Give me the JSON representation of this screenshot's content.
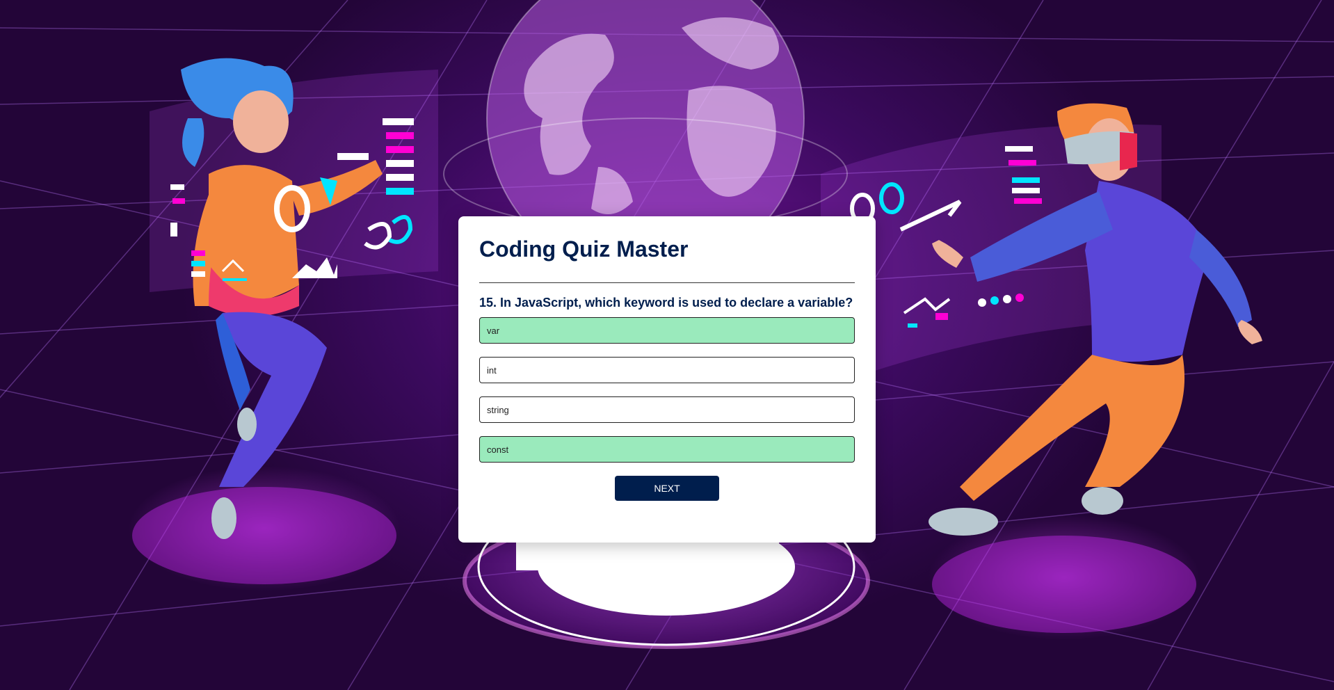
{
  "quiz": {
    "title": "Coding Quiz Master",
    "question": "15. In JavaScript, which keyword is used to declare a variable?",
    "answers": [
      {
        "text": "var",
        "state": "correct"
      },
      {
        "text": "int",
        "state": "neutral"
      },
      {
        "text": "string",
        "state": "neutral"
      },
      {
        "text": "const",
        "state": "correct"
      }
    ],
    "next_label": "NEXT"
  },
  "colors": {
    "primary": "#001e4d",
    "correct": "#9aeabc",
    "background": "#3b0a5e",
    "accent_magenta": "#ff00d4",
    "accent_cyan": "#00e5ff"
  },
  "background_illustration": {
    "elements": [
      "globe-icon",
      "woman-vr-figure",
      "man-vr-figure",
      "hologram-pedestal",
      "floating-ui-panels"
    ]
  }
}
